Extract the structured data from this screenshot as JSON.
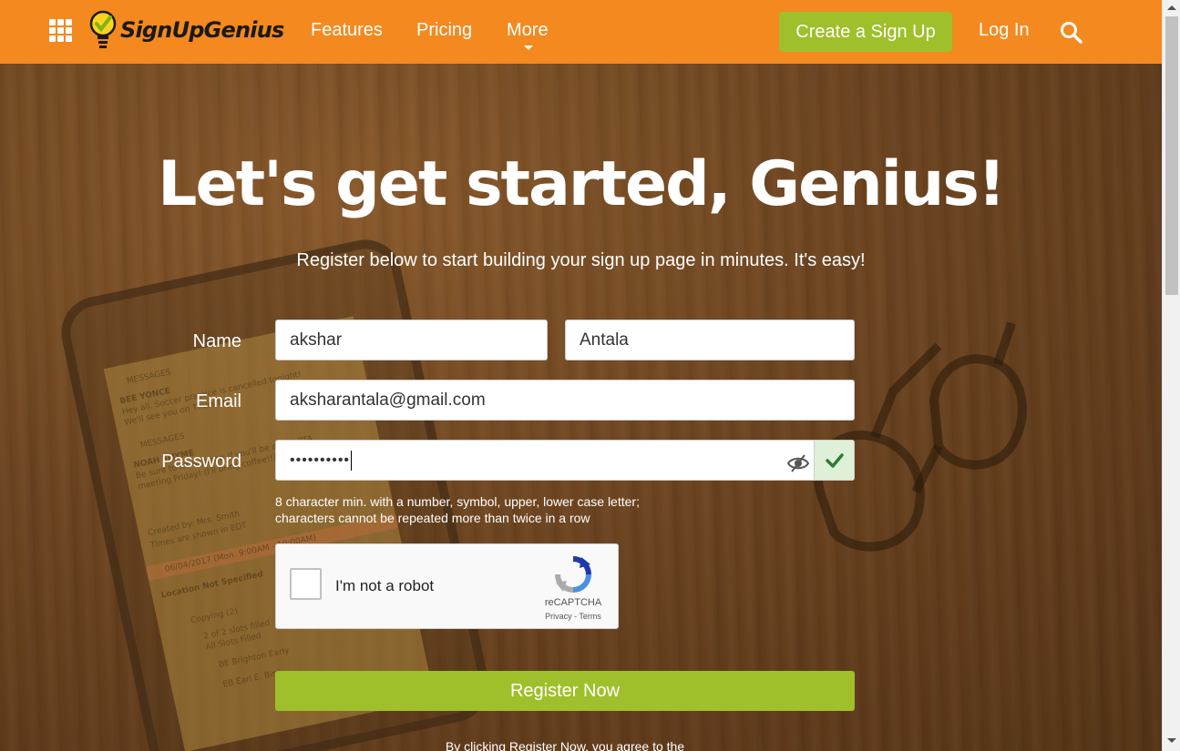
{
  "header": {
    "logo_text": "SignUpGenius",
    "nav": {
      "features": "Features",
      "pricing": "Pricing",
      "more": "More"
    },
    "create_button": "Create a Sign Up",
    "login": "Log In"
  },
  "hero": {
    "title": "Let's get started, Genius!",
    "subtitle": "Register below to start building your sign up page in minutes. It's easy!"
  },
  "form": {
    "name_label": "Name",
    "first_name": "akshar",
    "last_name": "Antala",
    "email_label": "Email",
    "email": "aksharantala@gmail.com",
    "password_label": "Password",
    "password_masked": "••••••••••",
    "password_hint_1": "8 character min. with a number, symbol, upper, lower case letter;",
    "password_hint_2": "characters cannot be repeated more than twice in a row",
    "register_button": "Register Now",
    "terms_text": "By clicking Register Now, you agree to the"
  },
  "captcha": {
    "label": "I'm not a robot",
    "brand": "reCAPTCHA",
    "links": "Privacy - Terms"
  },
  "phone_screen": {
    "messages_1": "MESSAGES",
    "sender_1": "BEE YONCE",
    "text_1": "Hey all. Soccer practice is cancelled tonight!",
    "text_1b": "We'll see you on Thursday.",
    "messages_2": "MESSAGES",
    "sender_2": "NOAH THYME",
    "text_2": "Be sure to let us know if you'll be at the PTA",
    "text_2b": "meeting Friday! (I'll bring coffee!!)",
    "created_by": "Created by: Mrs. Smith",
    "times": "Times are shown in EDT",
    "date": "06/04/2017 (Mon. 9:00AM - 10:00AM)",
    "location": "Location Not Specified",
    "copying": "Copying (2)",
    "slots": "2 of 2 slots filled",
    "all_filled": "All Slots Filled",
    "person_1": "BE  Brighton Early",
    "person_2": "EB  Earl E. Bird"
  },
  "colors": {
    "header": "#f4891f",
    "accent_green": "#9fbf2b"
  }
}
